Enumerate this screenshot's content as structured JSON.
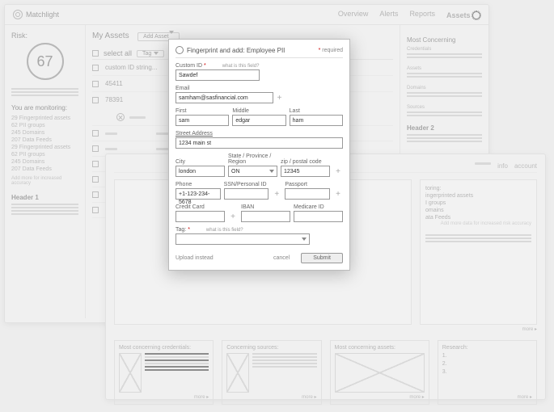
{
  "app": {
    "name": "Matchlight"
  },
  "nav": {
    "overview": "Overview",
    "alerts": "Alerts",
    "reports": "Reports",
    "assets": "Assets"
  },
  "risk": {
    "label": "Risk:",
    "score": "67"
  },
  "monitoring": {
    "title": "You are monitoring:",
    "items": [
      {
        "count": "29",
        "label": "Fingerprinted assets"
      },
      {
        "count": "62",
        "label": "PII groups"
      },
      {
        "count": "245",
        "label": "Domains"
      },
      {
        "count": "207",
        "label": "Data Feeds"
      },
      {
        "count": "29",
        "label": "Fingerprinted assets"
      },
      {
        "count": "62",
        "label": "PII groups"
      },
      {
        "count": "245",
        "label": "Domains"
      },
      {
        "count": "207",
        "label": "Data Feeds"
      }
    ],
    "add": "Add more for increased accuracy"
  },
  "header1": {
    "title": "Header 1"
  },
  "assets": {
    "title": "My Assets",
    "add_btn": "Add Asset",
    "select_all": "select all",
    "tag_btn": "Tag",
    "rows": [
      {
        "label": "custom ID string..."
      },
      {
        "label": "45411"
      },
      {
        "label": "78391"
      }
    ]
  },
  "right": {
    "most_concerning": "Most Concerning",
    "credentials": "Credentials",
    "assets_label": "Assets",
    "domains": "Domains",
    "sources": "Sources"
  },
  "header2": {
    "title": "Header 2"
  },
  "second_nav": {
    "info": "info",
    "account": "account"
  },
  "monitoring2": {
    "title": "toring:",
    "items": [
      "ingerprinted assets",
      "I groups",
      "omains",
      "ata Feeds"
    ],
    "add": "Add more data for\nincreased risk accuracy"
  },
  "cards": {
    "cred": "Most concerning credentials:",
    "sources": "Concerning sources:",
    "assets": "Most concerning assets:",
    "research": "Research:",
    "more": "more ▸",
    "research_items": [
      "1.",
      "2.",
      "3."
    ]
  },
  "modal": {
    "title": "Fingerprint and add: Employee PII",
    "required": " required",
    "custom_id": {
      "label": "Custom ID",
      "hint": "what is this field?",
      "value": "Sawdef"
    },
    "email": {
      "label": "Email",
      "value": "samham@sasfinancial.com"
    },
    "first": {
      "label": "First",
      "value": "sam"
    },
    "middle": {
      "label": "Middle",
      "value": "edgar"
    },
    "last": {
      "label": "Last",
      "value": "ham"
    },
    "street": {
      "label": "Street Address",
      "value": "1234 main st"
    },
    "city": {
      "label": "City",
      "value": "london"
    },
    "state": {
      "label": "State / Province / Region",
      "value": "ON"
    },
    "zip": {
      "label": "zip / postal code",
      "value": "12345"
    },
    "phone": {
      "label": "Phone",
      "value": "+1-123-234-5678"
    },
    "ssn": {
      "label": "SSN/Personal ID",
      "value": ""
    },
    "passport": {
      "label": "Passport",
      "value": ""
    },
    "cc": {
      "label": "Credit Card",
      "value": ""
    },
    "iban": {
      "label": "IBAN",
      "value": ""
    },
    "medicare": {
      "label": "Medicare ID",
      "value": ""
    },
    "tag": {
      "label": "Tag:",
      "hint": "what is this field?"
    },
    "upload": "Upload instead",
    "cancel": "cancel",
    "submit": "Submit"
  }
}
